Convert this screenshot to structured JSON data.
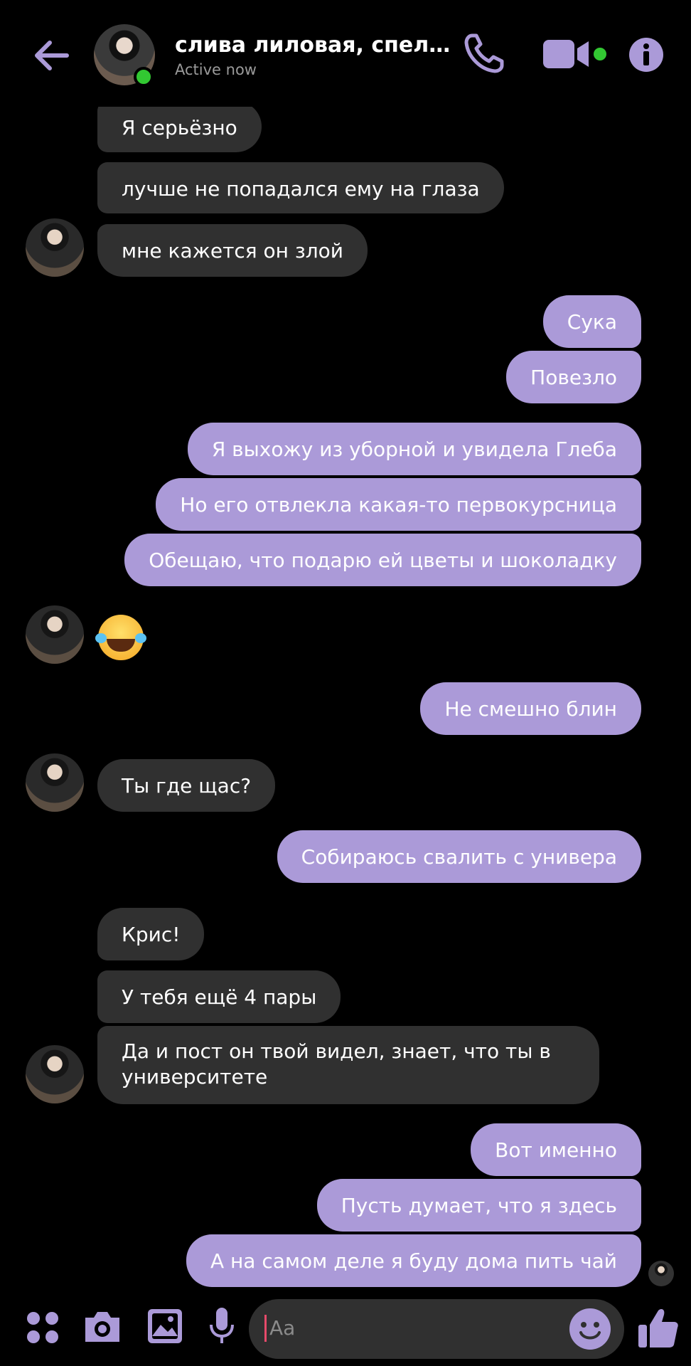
{
  "header": {
    "name": "слива лиловая, спелая, с...",
    "status": "Active now"
  },
  "colors": {
    "accent": "#ab9ad8",
    "incoming_bubble": "#303030",
    "online": "#32c832"
  },
  "messages": [
    {
      "side": "in",
      "text": "Я серьёзно"
    },
    {
      "side": "in",
      "text": "лучше не попадался ему на глаза"
    },
    {
      "side": "in",
      "text": "мне кажется он злой"
    },
    {
      "side": "out",
      "text": "Сука"
    },
    {
      "side": "out",
      "text": "Повезло"
    },
    {
      "side": "out",
      "text": "Я выхожу из уборной и увидела Глеба"
    },
    {
      "side": "out",
      "text": "Но его отвлекла какая-то первокурсница"
    },
    {
      "side": "out",
      "text": "Обещаю, что подарю ей цветы и шоколадку"
    },
    {
      "side": "in",
      "text": "😂"
    },
    {
      "side": "out",
      "text": "Не смешно блин"
    },
    {
      "side": "in",
      "text": "Ты где щас?"
    },
    {
      "side": "out",
      "text": "Собираюсь свалить с универа"
    },
    {
      "side": "in",
      "text": "Крис!"
    },
    {
      "side": "in",
      "text": "У тебя ещё 4 пары"
    },
    {
      "side": "in",
      "text": "Да и пост он твой видел, знает, что ты в университете"
    },
    {
      "side": "out",
      "text": "Вот именно"
    },
    {
      "side": "out",
      "text": "Пусть думает, что я здесь"
    },
    {
      "side": "out",
      "text": "А на самом деле я буду дома пить чай"
    }
  ],
  "composer": {
    "placeholder": "Aa",
    "icons": [
      "apps-icon",
      "camera-icon",
      "gallery-icon",
      "microphone-icon",
      "emoji-icon",
      "thumbs-up-icon"
    ]
  },
  "header_icons": [
    "back-arrow-icon",
    "phone-icon",
    "video-camera-icon",
    "info-icon"
  ]
}
